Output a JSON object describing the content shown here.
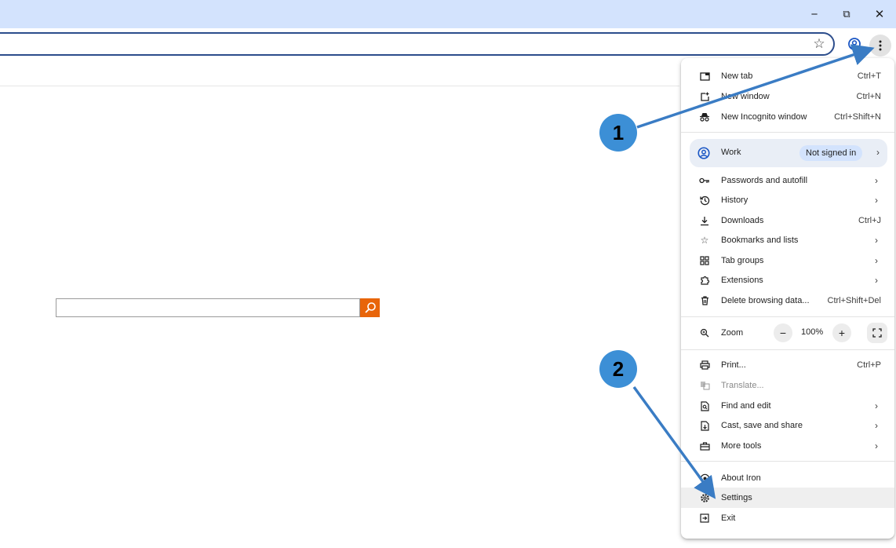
{
  "window": {
    "minimize_glyph": "−",
    "restore_glyph": "⧉",
    "close_glyph": "✕"
  },
  "toolbar": {
    "star_icon": "star-icon",
    "profile_icon": "profile-icon",
    "menu_icon": "kebab-menu-icon"
  },
  "menu": {
    "new_tab": {
      "label": "New tab",
      "shortcut": "Ctrl+T"
    },
    "new_window": {
      "label": "New window",
      "shortcut": "Ctrl+N"
    },
    "new_incognito": {
      "label": "New Incognito window",
      "shortcut": "Ctrl+Shift+N"
    },
    "profile": {
      "label": "Work",
      "badge": "Not signed in"
    },
    "passwords": {
      "label": "Passwords and autofill"
    },
    "history": {
      "label": "History"
    },
    "downloads": {
      "label": "Downloads",
      "shortcut": "Ctrl+J"
    },
    "bookmarks": {
      "label": "Bookmarks and lists"
    },
    "tab_groups": {
      "label": "Tab groups"
    },
    "extensions": {
      "label": "Extensions"
    },
    "delete_data": {
      "label": "Delete browsing data...",
      "shortcut": "Ctrl+Shift+Del"
    },
    "zoom": {
      "label": "Zoom",
      "value": "100%",
      "minus": "−",
      "plus": "+"
    },
    "print": {
      "label": "Print...",
      "shortcut": "Ctrl+P"
    },
    "translate": {
      "label": "Translate..."
    },
    "find_edit": {
      "label": "Find and edit"
    },
    "cast": {
      "label": "Cast, save and share"
    },
    "more_tools": {
      "label": "More tools"
    },
    "about": {
      "label": "About Iron"
    },
    "settings": {
      "label": "Settings"
    },
    "exit": {
      "label": "Exit"
    }
  },
  "annotations": {
    "step1": "1",
    "step2": "2"
  },
  "colors": {
    "titlebar": "#d3e3fd",
    "accent_border": "#2c4d8c",
    "search_button": "#e8650a",
    "annotation": "#3c8fd6"
  }
}
